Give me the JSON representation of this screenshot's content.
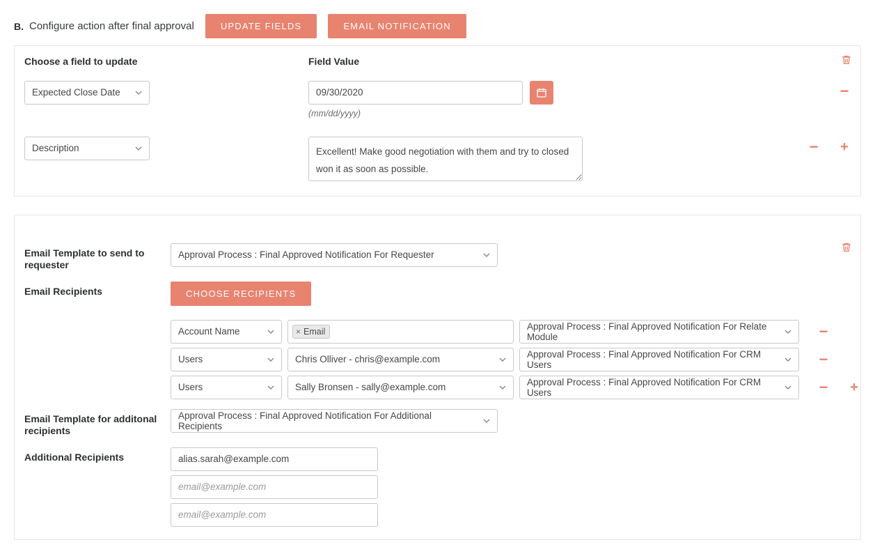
{
  "colors": {
    "accent": "#e8836f"
  },
  "header": {
    "step": "B.",
    "title": "Configure action after final approval",
    "buttons": {
      "update_fields": "UPDATE FIELDS",
      "email_notification": "EMAIL NOTIFICATION"
    }
  },
  "update_panel": {
    "labels": {
      "choose_field": "Choose a field to update",
      "field_value": "Field Value"
    },
    "rows": [
      {
        "field": "Expected Close Date",
        "type": "date",
        "value": "09/30/2020",
        "hint": "(mm/dd/yyyy)"
      },
      {
        "field": "Description",
        "type": "textarea",
        "value": "Excellent! Make good negotiation with them and try to closed won it as soon as possible."
      }
    ]
  },
  "email_panel": {
    "labels": {
      "template_requester": "Email Template to send to requester",
      "recipients": "Email Recipients",
      "template_additional": "Email Template for additonal recipients",
      "additional_recipients": "Additional Recipients"
    },
    "buttons": {
      "choose_recipients": "CHOOSE RECIPIENTS"
    },
    "template_requester": "Approval Process : Final Approved Notification For Requester",
    "recipient_rows": [
      {
        "source": "Account Name",
        "mid_type": "tag",
        "tag": "Email",
        "template": "Approval Process : Final Approved Notification For Relate Module"
      },
      {
        "source": "Users",
        "mid_type": "select",
        "mid_value": "Chris Olliver - chris@example.com",
        "template": "Approval Process : Final Approved Notification For CRM Users"
      },
      {
        "source": "Users",
        "mid_type": "select",
        "mid_value": "Sally Bronsen - sally@example.com",
        "template": "Approval Process : Final Approved Notification For CRM Users"
      }
    ],
    "template_additional": "Approval Process : Final Approved Notification For Additional Recipients",
    "additional_inputs": [
      {
        "value": "alias.sarah@example.com",
        "placeholder": "email@example.com"
      },
      {
        "value": "",
        "placeholder": "email@example.com"
      },
      {
        "value": "",
        "placeholder": "email@example.com"
      }
    ]
  }
}
